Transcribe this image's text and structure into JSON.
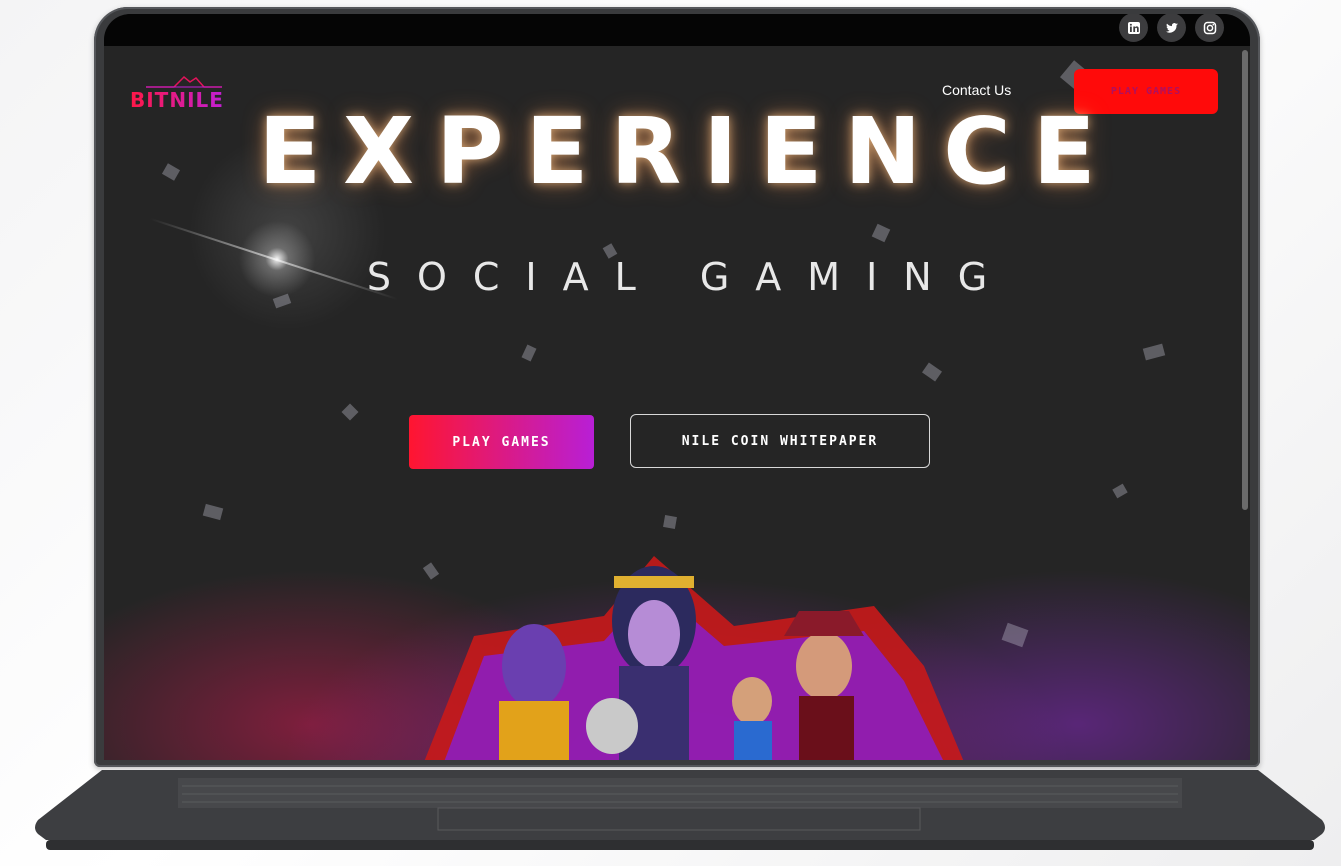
{
  "social": [
    {
      "name": "linkedin",
      "icon": "linkedin-icon"
    },
    {
      "name": "twitter",
      "icon": "twitter-icon"
    },
    {
      "name": "instagram",
      "icon": "instagram-icon"
    }
  ],
  "header": {
    "logo_text": "BITNILE",
    "contact_label": "Contact Us",
    "play_label": "PLAY GAMES"
  },
  "hero": {
    "headline": "EXPERIENCE",
    "subheadline": "SOCIAL GAMING",
    "primary_button": "PLAY GAMES",
    "secondary_button": "NILE COIN WHITEPAPER"
  },
  "colors": {
    "accent_red": "#ff0a0a",
    "gradient_start": "#ff1530",
    "gradient_end": "#b81fd6",
    "background": "#252525"
  }
}
